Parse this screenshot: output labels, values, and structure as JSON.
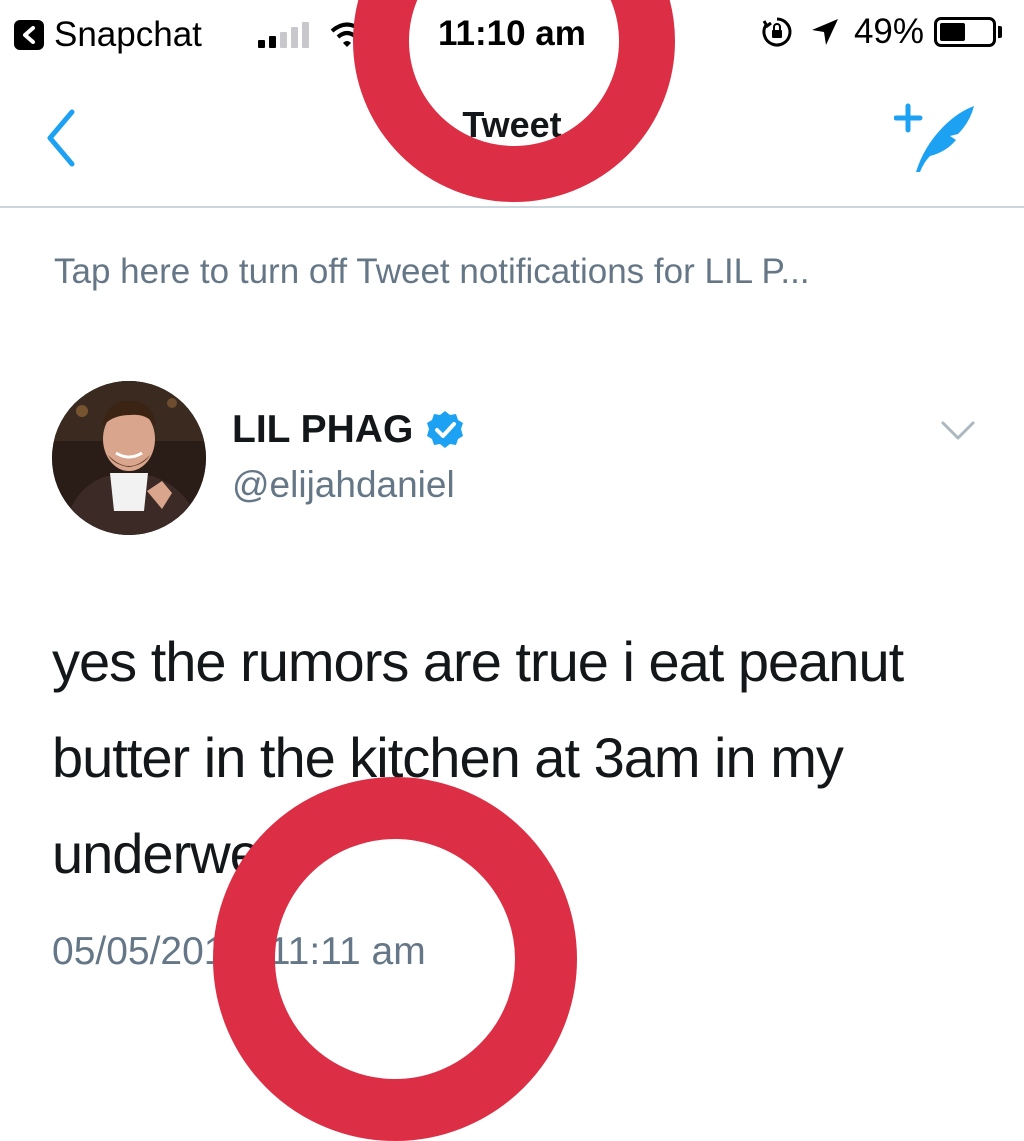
{
  "status_bar": {
    "back_app_name": "Snapchat",
    "time": "11:10 am",
    "battery_percent": "49%",
    "battery_level": 0.49,
    "signal_bars_active": 2,
    "signal_bars_total": 5
  },
  "nav": {
    "title": "Tweet",
    "back_icon": "chevron-left-icon",
    "compose_icon": "compose-tweet-icon"
  },
  "notification_banner": {
    "text": "Tap here to turn off Tweet notifications for LIL P..."
  },
  "tweet": {
    "display_name": "LIL PHAG",
    "handle": "@elijahdaniel",
    "verified": true,
    "text": "yes the rumors are true i eat peanut butter in the kitchen at 3am in my underwear",
    "timestamp": "05/05/2018, 11:11 am"
  },
  "colors": {
    "accent": "#1da1f2",
    "secondary_text": "#657786",
    "annotation_red": "#dc2f45"
  }
}
